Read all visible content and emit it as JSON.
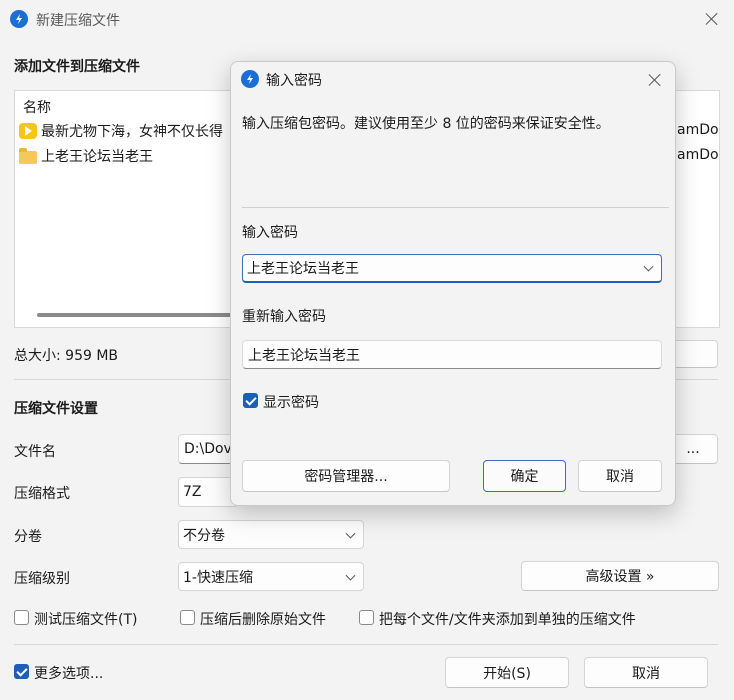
{
  "main": {
    "title": "新建压缩文件",
    "section_add": "添加文件到压缩文件",
    "list": {
      "header": "名称",
      "items": [
        {
          "name": "最新尤物下海，女神不仅长得",
          "tail": "amDov",
          "icon": "video-file-icon"
        },
        {
          "name": "上老王论坛当老王",
          "tail": "amDov",
          "icon": "folder-icon"
        }
      ]
    },
    "total_size": "总大小: 959 MB",
    "section_settings": "压缩文件设置",
    "filename_label": "文件名",
    "filename_value": "D:\\Dov",
    "browse_label": "...",
    "format_label": "压缩格式",
    "format_value": "7Z",
    "split_label": "分卷",
    "split_value": "不分卷",
    "level_label": "压缩级别",
    "level_value": "1-快速压缩",
    "advanced_label": "高级设置 »",
    "test_label": "测试压缩文件(T)",
    "delete_label": "压缩后删除原始文件",
    "each_label": "把每个文件/文件夹添加到单独的压缩文件",
    "more_label": "更多选项...",
    "start_label": "开始(S)",
    "cancel_label": "取消"
  },
  "dialog": {
    "title": "输入密码",
    "description": "输入压缩包密码。建议使用至少 8 位的密码来保证安全性。",
    "password_label": "输入密码",
    "password_value": "上老王论坛当老王",
    "reenter_label": "重新输入密码",
    "reenter_value": "上老王论坛当老王",
    "show_password_label": "显示密码",
    "manager_label": "密码管理器...",
    "ok_label": "确定",
    "cancel_label": "取消"
  }
}
